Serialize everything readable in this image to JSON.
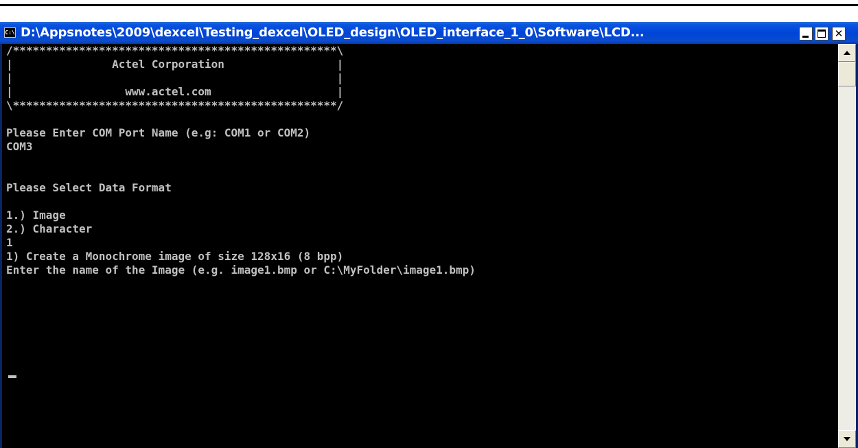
{
  "window": {
    "title": "D:\\Appsnotes\\2009\\dexcel\\Testing_dexcel\\OLED_design\\OLED_interface_1_0\\Software\\LCD...",
    "icon_label": "C:\\",
    "close_glyph": "✕"
  },
  "console": {
    "lines": [
      "/*************************************************\\",
      "|               Actel Corporation                 |",
      "|                                                 |",
      "|                 www.actel.com                   |",
      "\\*************************************************/",
      "",
      "Please Enter COM Port Name (e.g: COM1 or COM2)",
      "COM3",
      "",
      "",
      "Please Select Data Format",
      "",
      "1.) Image",
      "2.) Character",
      "1",
      "1) Create a Monochrome image of size 128x16 (8 bpp)",
      "Enter the name of the Image (e.g. image1.bmp or C:\\MyFolder\\image1.bmp)"
    ]
  },
  "colors": {
    "titlebar": "#0044d8",
    "console_bg": "#000000",
    "console_text": "#c0c0c0",
    "scrollbar": "#eeede5"
  },
  "icons": {
    "app": "console-app-icon",
    "minimize": "minimize-icon",
    "maximize": "maximize-icon",
    "close": "close-icon",
    "scroll_up": "arrow-up-icon",
    "scroll_down": "arrow-down-icon"
  }
}
